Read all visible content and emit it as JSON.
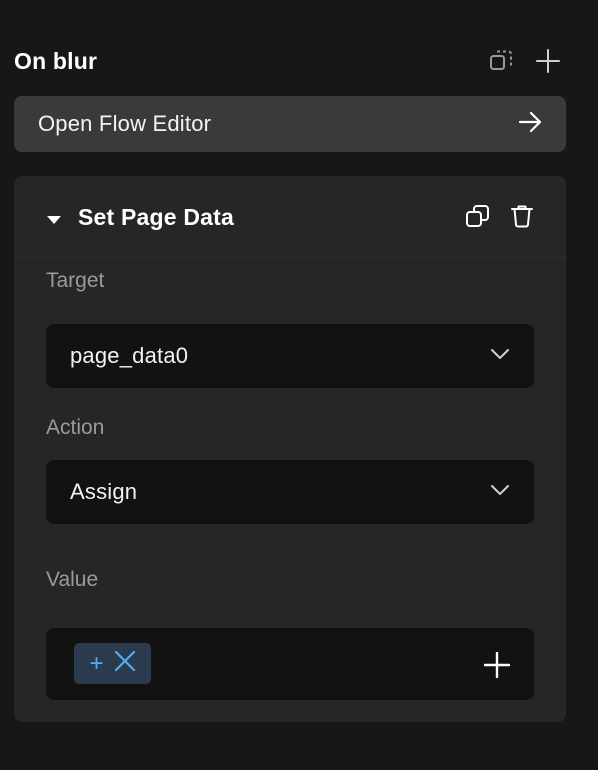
{
  "header": {
    "title": "On blur"
  },
  "flow_editor": {
    "label": "Open Flow Editor"
  },
  "action_card": {
    "title": "Set Page Data",
    "target": {
      "label": "Target",
      "value": "page_data0"
    },
    "action": {
      "label": "Action",
      "value": "Assign"
    },
    "value": {
      "label": "Value",
      "chip_plus": "+"
    }
  },
  "icons": {
    "header": [
      "duplicate-icon",
      "plus-icon"
    ],
    "flow_editor": "arrow-right-icon",
    "card": [
      "caret-down-icon",
      "copy-icon",
      "trash-icon"
    ],
    "select": "chevron-down-icon",
    "value": [
      "plus-icon",
      "close-icon"
    ]
  },
  "colors": {
    "background": "#171717",
    "card": "#262626",
    "button": "#3a3a3a",
    "input": "#121212",
    "chip": "#2b3b4e",
    "accent": "#5aa9ec"
  }
}
